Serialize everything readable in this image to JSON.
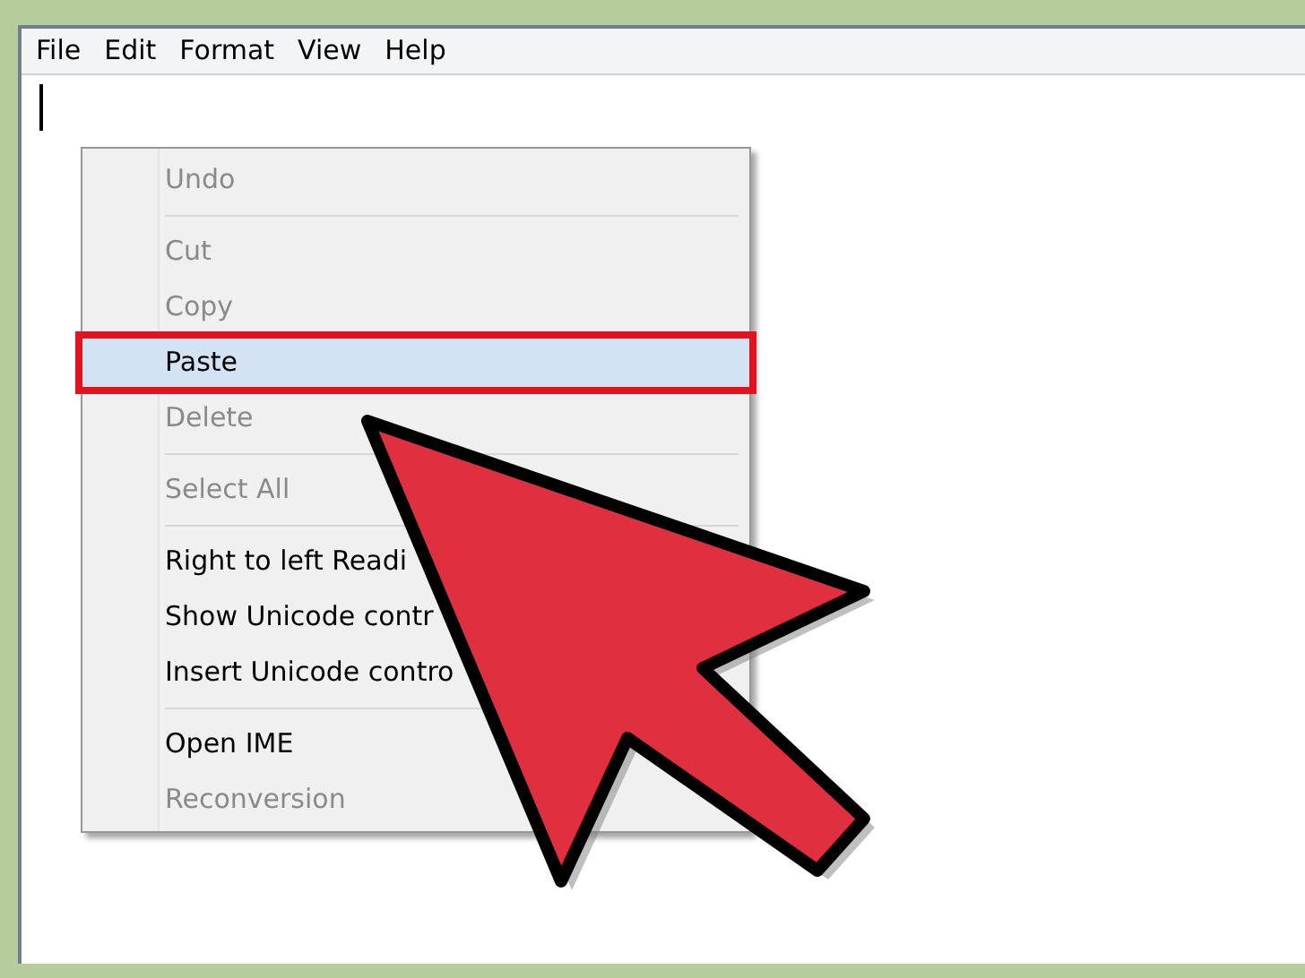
{
  "menu_bar": [
    {
      "label": "File"
    },
    {
      "label": "Edit"
    },
    {
      "label": "Format"
    },
    {
      "label": "View"
    },
    {
      "label": "Help"
    }
  ],
  "context_menu": {
    "groups": [
      {
        "items": [
          {
            "label": "Undo",
            "disabled": true,
            "selected": false
          }
        ]
      },
      {
        "items": [
          {
            "label": "Cut",
            "disabled": true,
            "selected": false
          },
          {
            "label": "Copy",
            "disabled": true,
            "selected": false
          },
          {
            "label": "Paste",
            "disabled": false,
            "selected": true
          },
          {
            "label": "Delete",
            "disabled": true,
            "selected": false
          }
        ]
      },
      {
        "items": [
          {
            "label": "Select All",
            "disabled": true,
            "selected": false
          }
        ]
      },
      {
        "items": [
          {
            "label": "Right to left Readi",
            "disabled": false,
            "selected": false
          },
          {
            "label": "Show Unicode contr",
            "disabled": false,
            "selected": false
          },
          {
            "label": "Insert Unicode contro",
            "disabled": false,
            "selected": false
          }
        ]
      },
      {
        "items": [
          {
            "label": "Open IME",
            "disabled": false,
            "selected": false
          },
          {
            "label": "Reconversion",
            "disabled": true,
            "selected": false
          }
        ]
      }
    ]
  }
}
